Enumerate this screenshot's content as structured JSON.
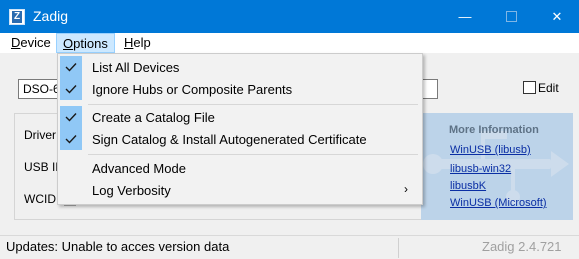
{
  "window": {
    "title": "Zadig",
    "app_icon": "zadig-icon",
    "app_icon_letter": "Z",
    "minimize_glyph": "—",
    "close_glyph": "✕"
  },
  "menubar": {
    "device": {
      "pre": "",
      "u": "D",
      "post": "evice"
    },
    "options": {
      "pre": "",
      "u": "O",
      "post": "ptions"
    },
    "help": {
      "pre": "",
      "u": "H",
      "post": "elp"
    }
  },
  "options_menu": {
    "items": [
      {
        "label": "List All Devices",
        "checked": true
      },
      {
        "label": "Ignore Hubs or Composite Parents",
        "checked": true
      },
      {
        "label": "Create a Catalog File",
        "checked": true
      },
      {
        "label": "Sign Catalog & Install Autogenerated Certificate",
        "checked": true
      },
      {
        "label": "Advanced Mode",
        "checked": false
      },
      {
        "label": "Log Verbosity",
        "checked": false,
        "submenu": true
      }
    ],
    "submenu_arrow": "›"
  },
  "main": {
    "device_value": "DSO-6",
    "edit_label": "Edit",
    "driver_label": "Driver",
    "usbid_label": "USB ID",
    "wcid_label": "WCID"
  },
  "info_panel": {
    "title": "More Information",
    "links": [
      "WinUSB (libusb)",
      "libusb-win32",
      "libusbK",
      "WinUSB (Microsoft)"
    ]
  },
  "statusbar": {
    "message": "Updates: Unable to acces version data",
    "version": "Zadig 2.4.721"
  },
  "colors": {
    "titlebar": "#0078d7",
    "menu_highlight": "#cce8ff",
    "check_bg": "#90c8f6",
    "link": "#0a2ea4",
    "info_bg": "#bcd3e9"
  }
}
